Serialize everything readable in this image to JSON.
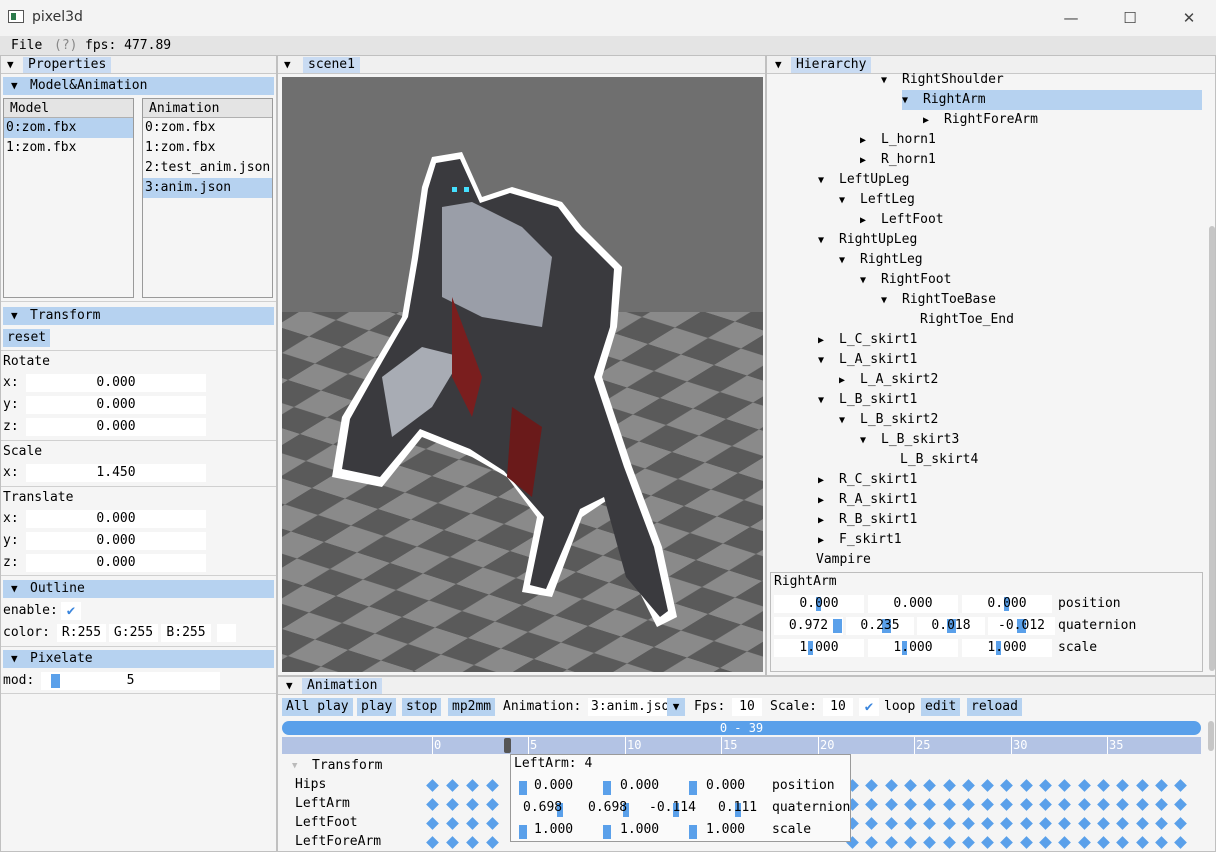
{
  "window": {
    "title": "pixel3d",
    "minimize": "—",
    "maximize": "☐",
    "close": "✕"
  },
  "menu": {
    "file": "File",
    "help": "(?)",
    "fps": "fps: 477.89"
  },
  "properties": {
    "title": "Properties",
    "model_anim": {
      "title": "Model&Animation",
      "model_header": "Model",
      "models": [
        "0:zom.fbx",
        "1:zom.fbx"
      ],
      "anim_header": "Animation",
      "anims": [
        "0:zom.fbx",
        "1:zom.fbx",
        "2:test_anim.json",
        "3:anim.json"
      ]
    },
    "transform": {
      "title": "Transform",
      "reset": "reset",
      "rotate_label": "Rotate",
      "rotate": {
        "x": "0.000",
        "y": "0.000",
        "z": "0.000"
      },
      "scale_label": "Scale",
      "scale": {
        "x": "1.450"
      },
      "translate_label": "Translate",
      "translate": {
        "x": "0.000",
        "y": "0.000",
        "z": "0.000"
      },
      "x": "x:",
      "y": "y:",
      "z": "z:"
    },
    "outline": {
      "title": "Outline",
      "enable_label": "enable:",
      "enable_checked": true,
      "color_label": "color:",
      "r": "R:255",
      "g": "G:255",
      "b": "B:255"
    },
    "pixelate": {
      "title": "Pixelate",
      "mod_label": "mod:",
      "mod_value": "5"
    }
  },
  "scene": {
    "title": "scene1"
  },
  "hierarchy": {
    "title": "Hierarchy",
    "nodes": [
      {
        "label": "RightShoulder",
        "arrow": "▼"
      },
      {
        "label": "RightArm",
        "arrow": "▼"
      },
      {
        "label": "RightForeArm",
        "arrow": "▶"
      },
      {
        "label": "L_horn1",
        "arrow": "▶"
      },
      {
        "label": "R_horn1",
        "arrow": "▶"
      },
      {
        "label": "LeftUpLeg",
        "arrow": "▼"
      },
      {
        "label": "LeftLeg",
        "arrow": "▼"
      },
      {
        "label": "LeftFoot",
        "arrow": "▶"
      },
      {
        "label": "RightUpLeg",
        "arrow": "▼"
      },
      {
        "label": "RightLeg",
        "arrow": "▼"
      },
      {
        "label": "RightFoot",
        "arrow": "▼"
      },
      {
        "label": "RightToeBase",
        "arrow": "▼"
      },
      {
        "label": "RightToe_End",
        "arrow": ""
      },
      {
        "label": "L_C_skirt1",
        "arrow": "▶"
      },
      {
        "label": "L_A_skirt1",
        "arrow": "▼"
      },
      {
        "label": "L_A_skirt2",
        "arrow": "▶"
      },
      {
        "label": "L_B_skirt1",
        "arrow": "▼"
      },
      {
        "label": "L_B_skirt2",
        "arrow": "▼"
      },
      {
        "label": "L_B_skirt3",
        "arrow": "▼"
      },
      {
        "label": "L_B_skirt4",
        "arrow": ""
      },
      {
        "label": "R_C_skirt1",
        "arrow": "▶"
      },
      {
        "label": "R_A_skirt1",
        "arrow": "▶"
      },
      {
        "label": "R_B_skirt1",
        "arrow": "▶"
      },
      {
        "label": "F_skirt1",
        "arrow": "▶"
      },
      {
        "label": "Vampire",
        "arrow": ""
      }
    ],
    "selected_bone": {
      "name": "RightArm",
      "position": [
        "0.000",
        "0.000",
        "0.000"
      ],
      "position_label": "position",
      "quaternion": [
        "0.972",
        "0.235",
        "0.018",
        "-0.012"
      ],
      "quaternion_levels": [
        0.972,
        0.235,
        0.018,
        -0.012
      ],
      "quaternion_label": "quaternion",
      "scale": [
        "1.000",
        "1.000",
        "1.000"
      ],
      "scale_label": "scale"
    }
  },
  "animation": {
    "title": "Animation",
    "all_play": "All play",
    "play": "play",
    "stop": "stop",
    "mp2mm": "mp2mm",
    "anim_label": "Animation:",
    "anim_value": "3:anim.json",
    "fps_label": "Fps:",
    "fps_value": "10",
    "scale_label": "Scale:",
    "scale_value": "10",
    "loop_label": "loop",
    "loop_checked": true,
    "edit": "edit",
    "reload": "reload",
    "range": "0 - 39",
    "ticks": [
      "0",
      "5",
      "10",
      "15",
      "20",
      "25",
      "30",
      "35"
    ],
    "track_header": "Transform",
    "tracks": [
      "Hips",
      "LeftArm",
      "LeftFoot",
      "LeftForeArm"
    ],
    "tooltip": {
      "title": "LeftArm: 4",
      "position": [
        "0.000",
        "0.000",
        "0.000"
      ],
      "position_label": "position",
      "quaternion": [
        "0.698",
        "0.698",
        "-0.114",
        "0.111"
      ],
      "quaternion_label": "quaternion",
      "scale": [
        "1.000",
        "1.000",
        "1.000"
      ],
      "scale_label": "scale"
    }
  },
  "colors": {
    "accent": "#5aa0ea",
    "selection": "#b6d2f0",
    "header": "#c9dbf2"
  },
  "icons": [
    "window-icon",
    "collapse-triangle-icon",
    "expand-triangle-icon",
    "checkmark-icon",
    "dropdown-arrow-icon",
    "diamond-keyframe-icon"
  ]
}
